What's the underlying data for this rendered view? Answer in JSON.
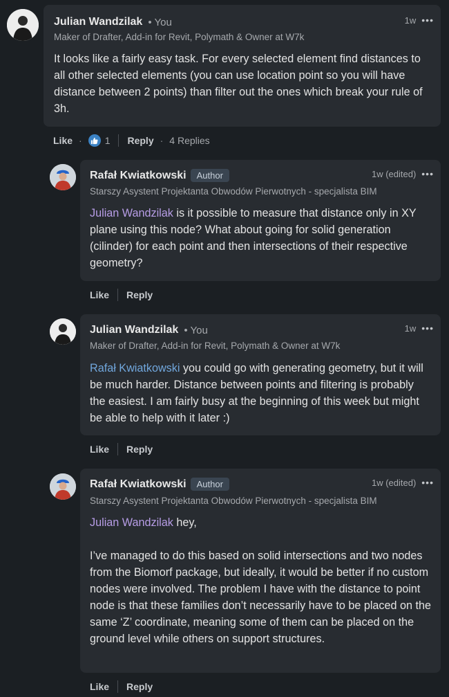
{
  "comments": [
    {
      "author": "Julian Wandzilak",
      "you_label": "You",
      "headline": "Maker of Drafter, Add-in for Revit, Polymath & Owner at W7k",
      "time": "1w",
      "text": "It looks like a fairly easy task. For every selected element find distances to all other selected elements (you can use location point so you will have distance between 2 points) than filter out the ones which break your rule of 3h.",
      "like_label": "Like",
      "reaction_count": "1",
      "reply_label": "Reply",
      "replies_label": "4 Replies"
    },
    {
      "author": "Rafał Kwiatkowski",
      "badge": "Author",
      "headline": "Starszy Asystent Projektanta Obwodów Pierwotnych - specjalista BIM",
      "time": "1w (edited)",
      "mention": "Julian Wandzilak",
      "text": " is it possible to measure that distance only in XY plane using this node? What about going for solid generation (cilinder) for each point and then intersections of their respective geometry?",
      "like_label": "Like",
      "reply_label": "Reply"
    },
    {
      "author": "Julian Wandzilak",
      "you_label": "You",
      "headline": "Maker of Drafter, Add-in for Revit, Polymath & Owner at W7k",
      "time": "1w",
      "mention": "Rafał Kwiatkowski",
      "text": " you could go with generating geometry, but it will be much harder. Distance between points and filtering is probably the easiest. I am fairly busy at the beginning of this week but might be able to help with it later :)",
      "like_label": "Like",
      "reply_label": "Reply"
    },
    {
      "author": "Rafał Kwiatkowski",
      "badge": "Author",
      "headline": "Starszy Asystent Projektanta Obwodów Pierwotnych - specjalista BIM",
      "time": "1w (edited)",
      "mention": "Julian Wandzilak",
      "text": " hey,",
      "text2": "I’ve managed to do this based on solid intersections and two nodes from the Biomorf package, but ideally, it would be better if no custom nodes were involved. The problem I have with the distance to point node is that these families don’t necessarily have to be placed on the same ‘Z’ coordinate, meaning some of them can be placed on the ground level while others on support structures.",
      "like_label": "Like",
      "reply_label": "Reply"
    }
  ],
  "icons": {
    "more": "more-horizontal-icon",
    "reaction": "thumbs-up-reaction-icon"
  },
  "colors": {
    "background": "#1b1f23",
    "bubble": "#282c31",
    "mention_purple": "#b79de6",
    "mention_blue": "#71a7dd",
    "reaction_blue": "#3b82c4"
  }
}
